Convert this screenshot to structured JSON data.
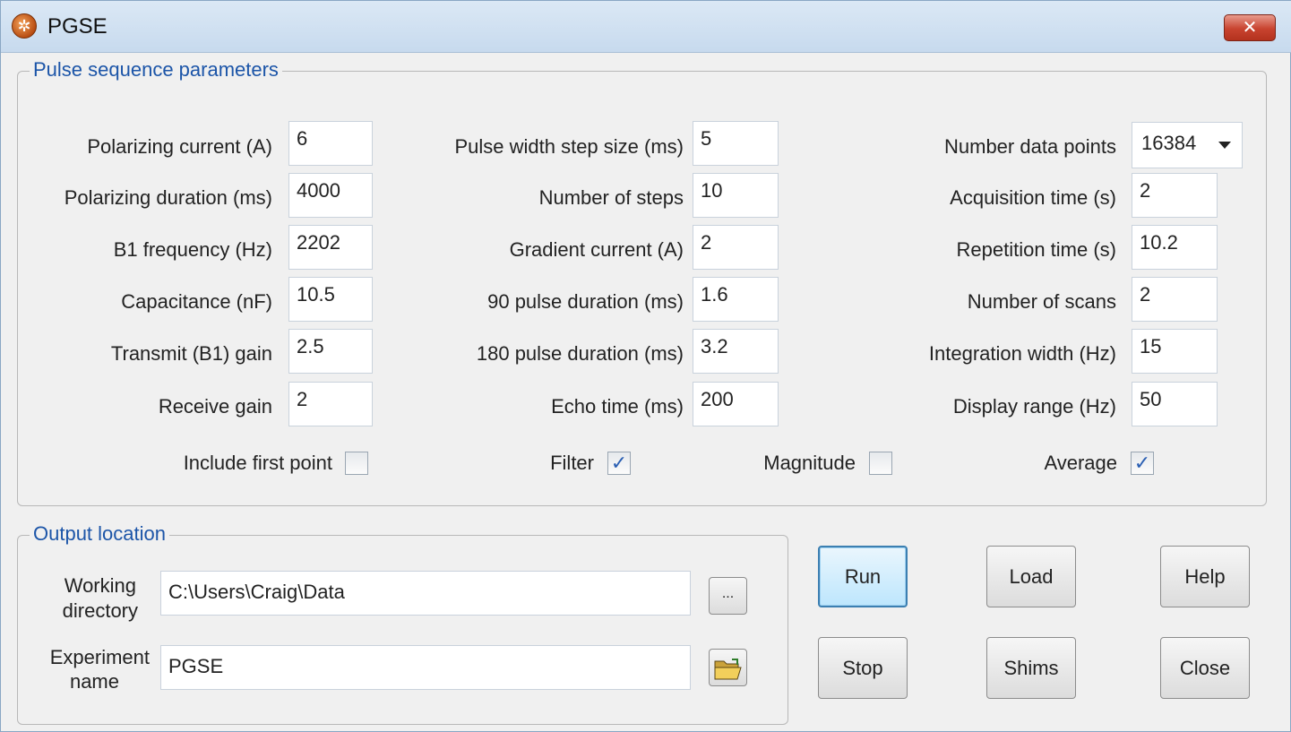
{
  "window": {
    "title": "PGSE",
    "close_glyph": "✕"
  },
  "params": {
    "legend": "Pulse sequence parameters",
    "col1": [
      {
        "label": "Polarizing current (A)",
        "value": "6"
      },
      {
        "label": "Polarizing duration (ms)",
        "value": "4000"
      },
      {
        "label": "B1 frequency (Hz)",
        "value": "2202"
      },
      {
        "label": "Capacitance (nF)",
        "value": "10.5"
      },
      {
        "label": "Transmit (B1) gain",
        "value": "2.5"
      },
      {
        "label": "Receive gain",
        "value": "2"
      }
    ],
    "col2": [
      {
        "label": "Pulse width step size (ms)",
        "value": "5"
      },
      {
        "label": "Number of steps",
        "value": "10"
      },
      {
        "label": "Gradient current (A)",
        "value": "2"
      },
      {
        "label": "90 pulse duration (ms)",
        "value": "1.6"
      },
      {
        "label": "180 pulse duration (ms)",
        "value": "3.2"
      },
      {
        "label": "Echo time (ms)",
        "value": "200"
      }
    ],
    "col3": [
      {
        "label": "Number data points",
        "value": "16384"
      },
      {
        "label": "Acquisition time (s)",
        "value": "2"
      },
      {
        "label": "Repetition time (s)",
        "value": "10.2"
      },
      {
        "label": "Number of scans",
        "value": "2"
      },
      {
        "label": "Integration width (Hz)",
        "value": "15"
      },
      {
        "label": "Display range (Hz)",
        "value": "50"
      }
    ],
    "checks": [
      {
        "label": "Include first point",
        "checked": false,
        "glyph": ""
      },
      {
        "label": "Filter",
        "checked": true,
        "glyph": "✓"
      },
      {
        "label": "Magnitude",
        "checked": false,
        "glyph": ""
      },
      {
        "label": "Average",
        "checked": true,
        "glyph": "✓"
      }
    ]
  },
  "output": {
    "legend": "Output location",
    "working_dir_label_1": "Working",
    "working_dir_label_2": "directory",
    "working_dir_value": "C:\\Users\\Craig\\Data",
    "browse_label": "...",
    "experiment_label_1": "Experiment",
    "experiment_label_2": "name",
    "experiment_value": "PGSE",
    "folder_icon": "open-folder-icon"
  },
  "buttons": {
    "run": "Run",
    "load": "Load",
    "help": "Help",
    "stop": "Stop",
    "shims": "Shims",
    "close": "Close"
  }
}
